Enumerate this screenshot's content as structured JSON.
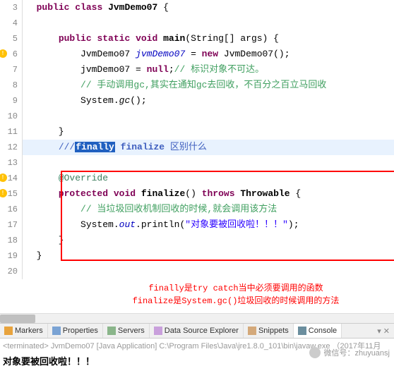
{
  "lines": [
    {
      "n": "3"
    },
    {
      "n": "4"
    },
    {
      "n": "5"
    },
    {
      "n": "6",
      "warn": true
    },
    {
      "n": "7"
    },
    {
      "n": "8"
    },
    {
      "n": "9"
    },
    {
      "n": "10"
    },
    {
      "n": "11"
    },
    {
      "n": "12",
      "hl": true
    },
    {
      "n": "13"
    },
    {
      "n": "14",
      "warn": true
    },
    {
      "n": "15",
      "warn": true
    },
    {
      "n": "16"
    },
    {
      "n": "17"
    },
    {
      "n": "18"
    },
    {
      "n": "19"
    },
    {
      "n": "20"
    }
  ],
  "tokens": {
    "public": "public",
    "class": "class",
    "static": "static",
    "void": "void",
    "new": "new",
    "null": "null",
    "throws": "throws",
    "protected": "protected",
    "className": "JvmDemo07",
    "main": "main",
    "mainArgs": "String[] args",
    "varName": "jvmDemo07",
    "comment1": "// 标识对象不可达。",
    "comment2": "// 手动调用gc,其实在通知gc去回收，不百分之百立马回收",
    "system": "System",
    "gc": "gc",
    "tripleSlash": "///",
    "finallyWord": "finally",
    "finalizeWord": "finalize",
    "diffText": " 区别什么",
    "override": "@Override",
    "finalize": "finalize",
    "throwable": "Throwable",
    "comment3": "// 当垃圾回收机制回收的时候,就会调用该方法",
    "out": "out",
    "println": "println",
    "printStr": "\"对象要被回收啦！！！\""
  },
  "annotation": {
    "line1": "finally是try catch当中必须要调用的函数",
    "line2": "finalize是System.gc()垃圾回收的时候调用的方法"
  },
  "tabs": {
    "markers": "Markers",
    "properties": "Properties",
    "servers": "Servers",
    "dataSource": "Data Source Explorer",
    "snippets": "Snippets",
    "console": "Console"
  },
  "terminfo": "<terminated> JvmDemo07 [Java Application] C:\\Program Files\\Java\\jre1.8.0_101\\bin\\javaw.exe （2017年11月",
  "output": "对象要被回收啦！！！",
  "wechat": "微信号：zhuyuansj"
}
